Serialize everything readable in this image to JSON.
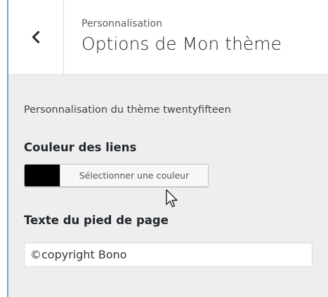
{
  "header": {
    "subtitle": "Personnalisation",
    "title": "Options de Mon thème"
  },
  "panel": {
    "description": "Personnalisation du thème twentyfifteen",
    "link_color": {
      "label": "Couleur des liens",
      "button_label": "Sélectionner une couleur",
      "swatch_color": "#000000"
    },
    "footer_text": {
      "label": "Texte du pied de page",
      "value": "©copyright Bono"
    }
  },
  "icons": {
    "back": "chevron-left-icon",
    "cursor": "mouse-pointer-icon"
  }
}
